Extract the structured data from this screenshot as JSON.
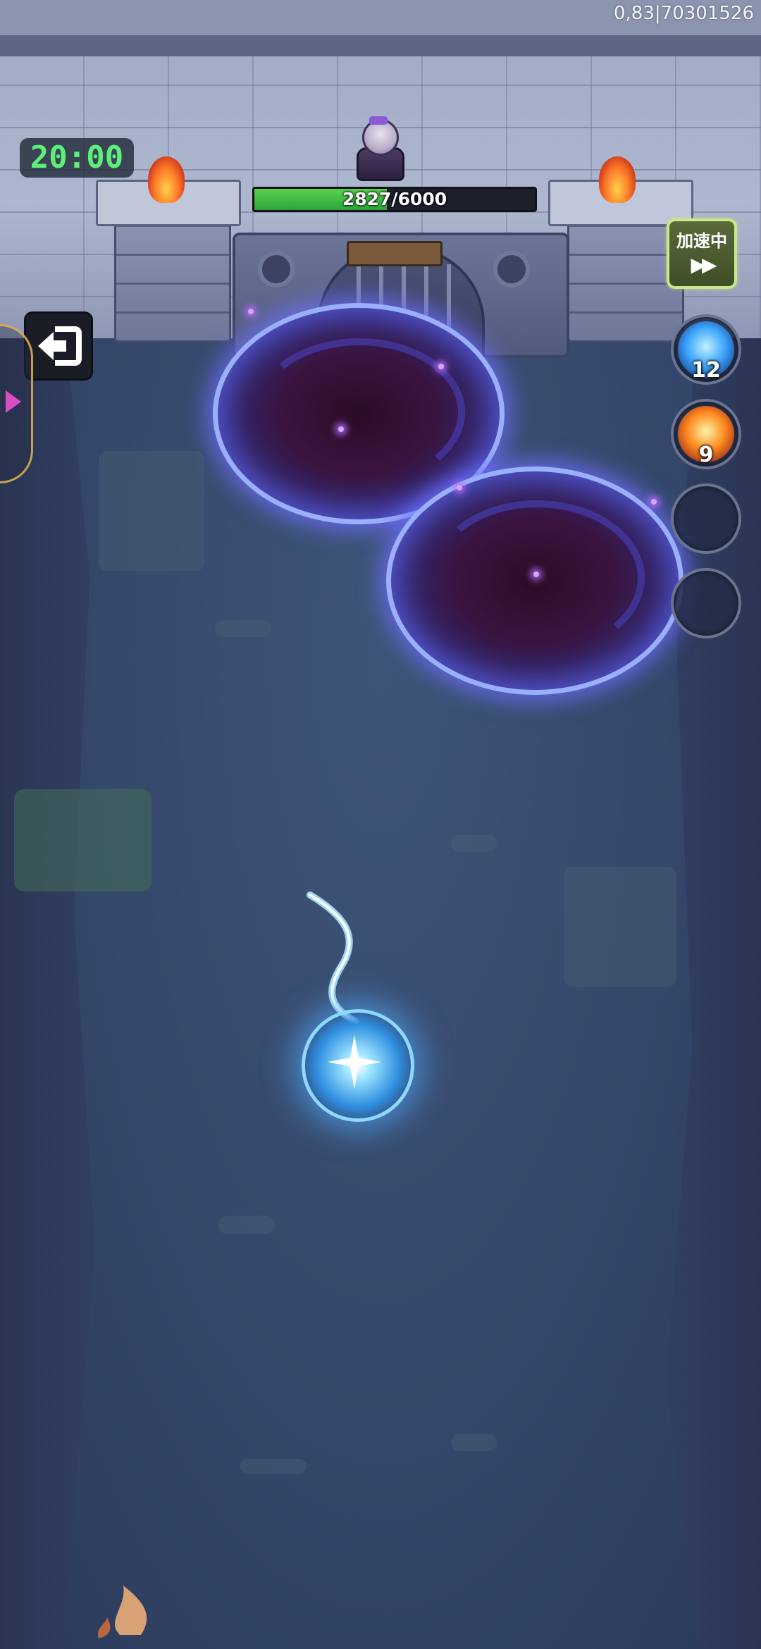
{
  "status": {
    "fps_readout": "0,83|70301526"
  },
  "timer": {
    "value": "20:00"
  },
  "boss": {
    "hp_current": "2827",
    "hp_separator": "/",
    "hp_max": "6000",
    "hp_fraction": 0.4712,
    "hp_color": "#3cb843"
  },
  "controls": {
    "exit_icon": "exit-icon",
    "speed": {
      "label": "加速中",
      "icon": "fast-forward-icon"
    }
  },
  "skills": [
    {
      "name": "lightning-skill-icon",
      "count": "12",
      "color": "#3fa6ff"
    },
    {
      "name": "fire-ring-skill-icon",
      "count": "9",
      "color": "#ff8a1f"
    },
    {
      "name": "empty-skill-slot",
      "count": "",
      "color": ""
    },
    {
      "name": "empty-skill-slot",
      "count": "",
      "color": ""
    }
  ]
}
